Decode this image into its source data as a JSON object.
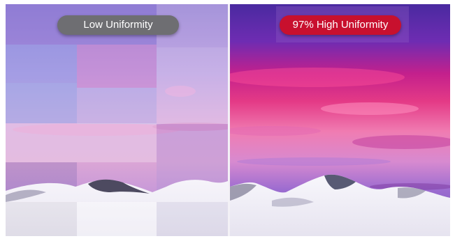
{
  "comparison": {
    "left": {
      "label": "Low Uniformity",
      "badge_color": "#6e6e72"
    },
    "right": {
      "label": "97% High Uniformity",
      "badge_color": "#c8102e"
    }
  }
}
